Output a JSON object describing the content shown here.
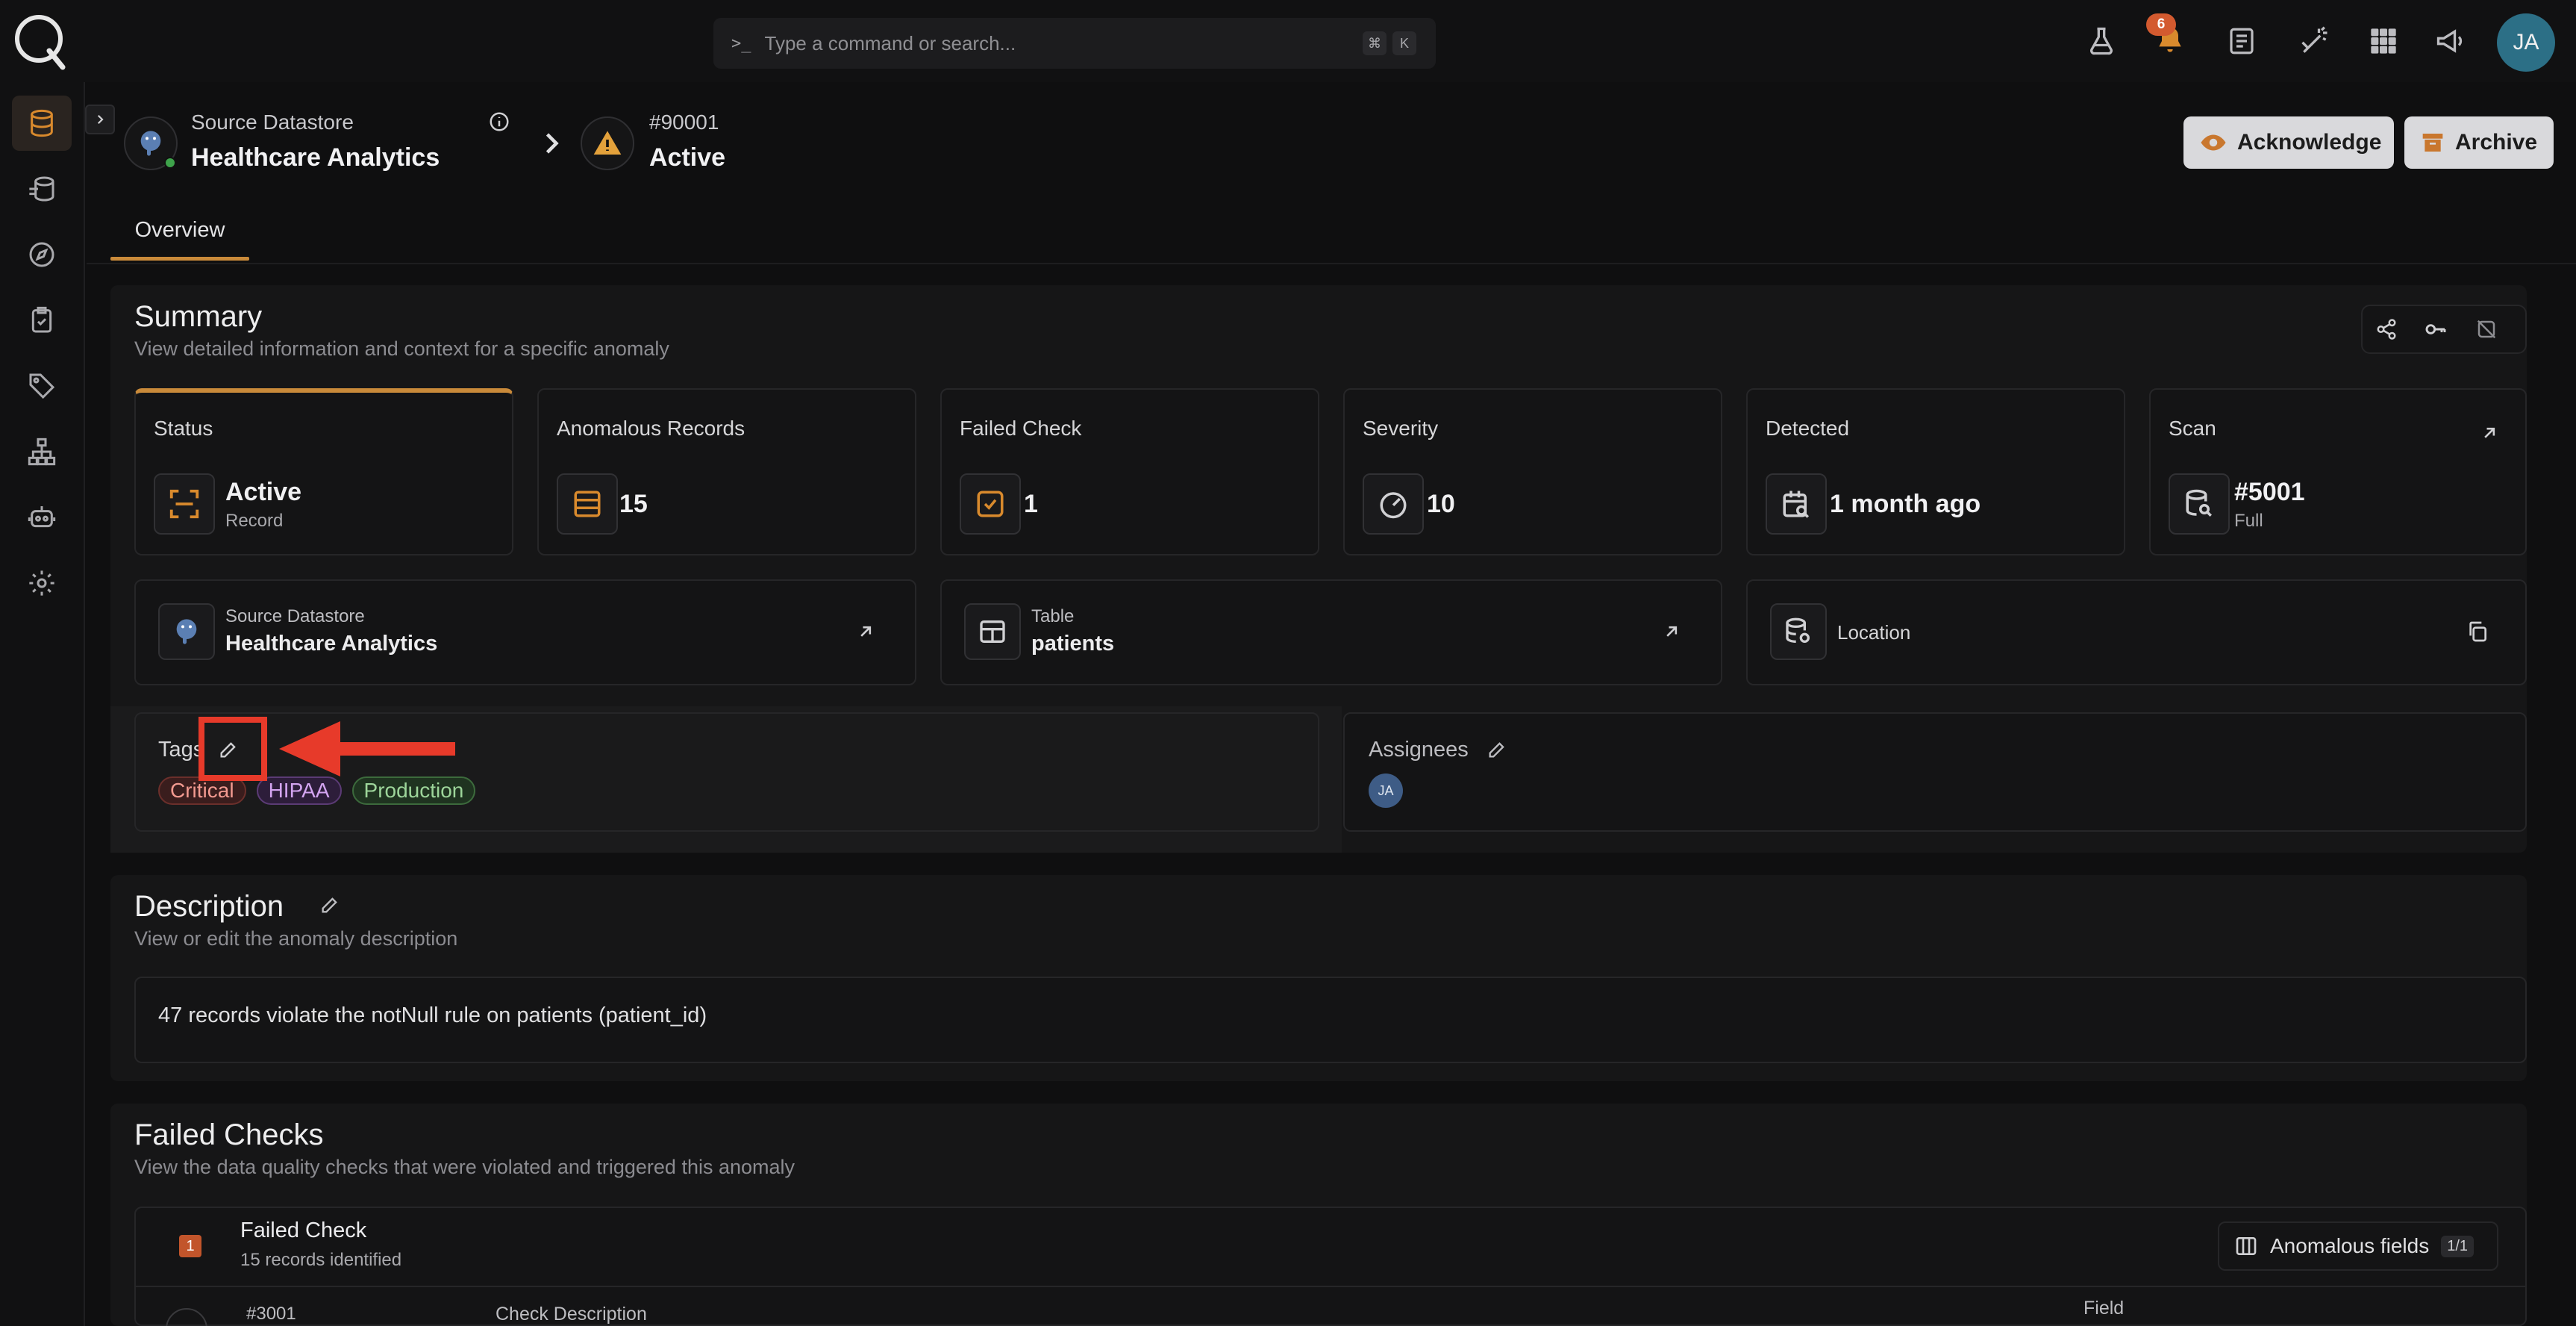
{
  "topbar": {
    "search_placeholder": "Type a command or search...",
    "shortcut_cmd": "⌘",
    "shortcut_key": "K",
    "notification_count": "6",
    "user_initials": "JA"
  },
  "breadcrumb": {
    "datastore_label": "Source Datastore",
    "datastore_name": "Healthcare Analytics",
    "anomaly_id": "#90001",
    "anomaly_status": "Active"
  },
  "actions": {
    "acknowledge": "Acknowledge",
    "archive": "Archive"
  },
  "tabs": [
    {
      "label": "Overview"
    }
  ],
  "summary": {
    "title": "Summary",
    "subtitle": "View detailed information and context for a specific anomaly",
    "cards": {
      "status": {
        "label": "Status",
        "value": "Active",
        "sub": "Record"
      },
      "anomalous_records": {
        "label": "Anomalous Records",
        "value": "15"
      },
      "failed_check": {
        "label": "Failed Check",
        "value": "1"
      },
      "severity": {
        "label": "Severity",
        "value": "10"
      },
      "detected": {
        "label": "Detected",
        "value": "1 month ago"
      },
      "scan": {
        "label": "Scan",
        "value": "#5001",
        "sub": "Full"
      }
    },
    "links": {
      "datastore": {
        "label": "Source Datastore",
        "value": "Healthcare Analytics"
      },
      "table": {
        "label": "Table",
        "value": "patients"
      },
      "location": {
        "label": "Location"
      }
    },
    "tags": {
      "label": "Tags",
      "items": [
        "Critical",
        "HIPAA",
        "Production"
      ]
    },
    "assignees": {
      "label": "Assignees",
      "initials": "JA"
    }
  },
  "description": {
    "title": "Description",
    "subtitle": "View or edit the anomaly description",
    "text": "47 records violate the notNull rule on patients (patient_id)"
  },
  "failed_checks": {
    "title": "Failed Checks",
    "subtitle": "View the data quality checks that were violated and triggered this anomaly",
    "count_badge": "1",
    "item_title": "Failed Check",
    "item_sub": "15 records identified",
    "fields_button": "Anomalous fields",
    "fields_count": "1/1",
    "row_id": "#3001",
    "col_check_description": "Check Description",
    "col_field": "Field"
  },
  "colors": {
    "accent": "#c98a3a",
    "annotation": "#e73a2a"
  }
}
